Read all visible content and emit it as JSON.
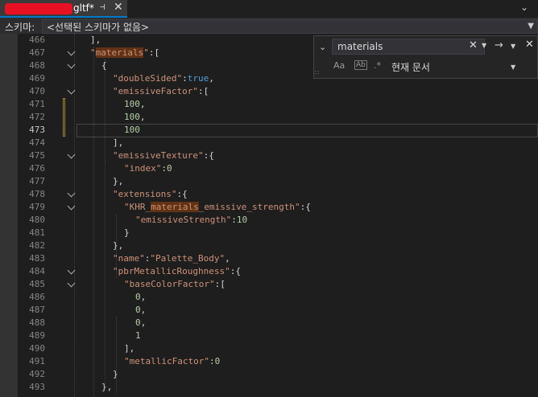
{
  "tab": {
    "title": "gltf*",
    "pin_icon": "pin-icon",
    "close_icon": "close-icon"
  },
  "schema": {
    "label": "스키마:",
    "value": "<선택된 스키마가 없음>"
  },
  "find": {
    "query": "materials",
    "match_case": "Aa",
    "whole_word": "Ab",
    "regex": ".*",
    "scope": "현재 문서"
  },
  "current_line": 473,
  "lines": [
    {
      "n": 466,
      "text": "],"
    },
    {
      "n": 467,
      "text": "\"materials\":["
    },
    {
      "n": 468,
      "text": "{"
    },
    {
      "n": 469,
      "text": "\"doubleSided\":true,"
    },
    {
      "n": 470,
      "text": "\"emissiveFactor\":["
    },
    {
      "n": 471,
      "text": "100,"
    },
    {
      "n": 472,
      "text": "100,"
    },
    {
      "n": 473,
      "text": "100"
    },
    {
      "n": 474,
      "text": "],"
    },
    {
      "n": 475,
      "text": "\"emissiveTexture\":{"
    },
    {
      "n": 476,
      "text": "\"index\":0"
    },
    {
      "n": 477,
      "text": "},"
    },
    {
      "n": 478,
      "text": "\"extensions\":{"
    },
    {
      "n": 479,
      "text": "\"KHR_materials_emissive_strength\":{"
    },
    {
      "n": 480,
      "text": "\"emissiveStrength\":10"
    },
    {
      "n": 481,
      "text": "}"
    },
    {
      "n": 482,
      "text": "},"
    },
    {
      "n": 483,
      "text": "\"name\":\"Palette_Body\","
    },
    {
      "n": 484,
      "text": "\"pbrMetallicRoughness\":{"
    },
    {
      "n": 485,
      "text": "\"baseColorFactor\":["
    },
    {
      "n": 486,
      "text": "0,"
    },
    {
      "n": 487,
      "text": "0,"
    },
    {
      "n": 488,
      "text": "0,"
    },
    {
      "n": 489,
      "text": "1"
    },
    {
      "n": 490,
      "text": "],"
    },
    {
      "n": 491,
      "text": "\"metallicFactor\":0"
    },
    {
      "n": 492,
      "text": "}"
    },
    {
      "n": 493,
      "text": "},"
    }
  ],
  "colors": {
    "accent": "#007acc",
    "string": "#ce9178",
    "number": "#b5cea8",
    "keyword": "#569cd6",
    "find_highlight": "#613214"
  }
}
